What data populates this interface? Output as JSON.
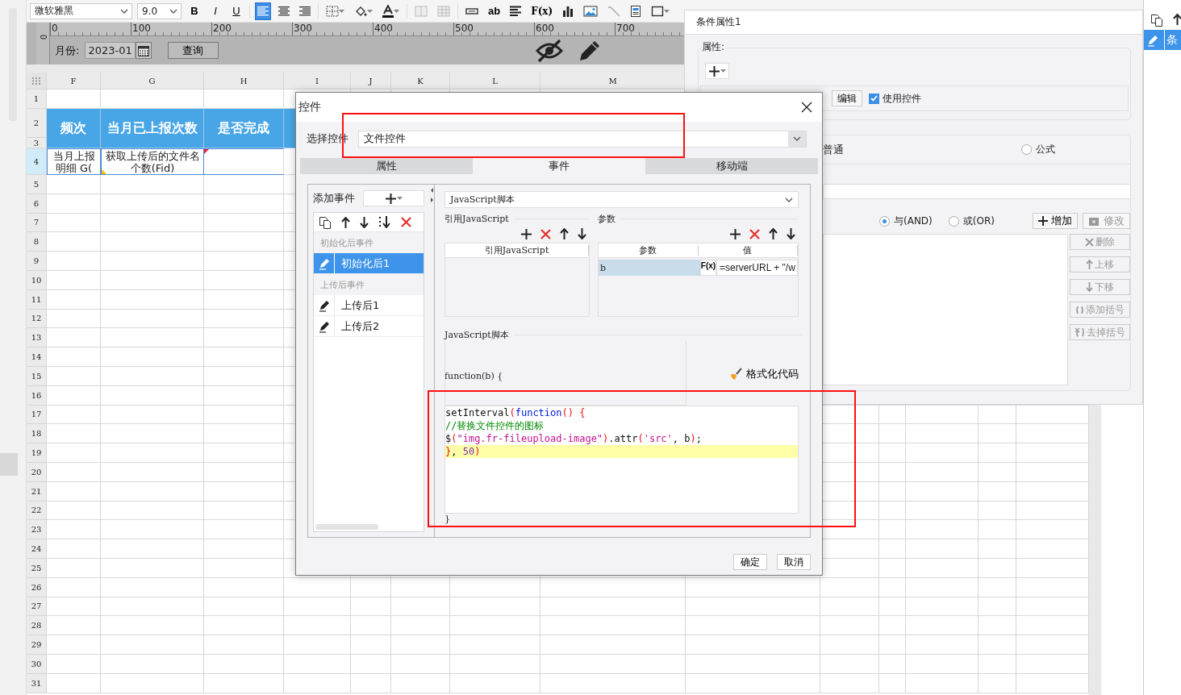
{
  "toolbar": {
    "font": "微软雅黑",
    "font_size": "9.0",
    "style_buttons": [
      "B",
      "I",
      "U"
    ],
    "align_buttons": [
      {
        "selected": true
      },
      {
        "selected": false
      },
      {
        "selected": false
      }
    ],
    "text_button": "ab",
    "formula_button": "F(x)"
  },
  "parameter_pane": {
    "ruler_labels": [
      "0",
      "100",
      "200",
      "300",
      "400",
      "500",
      "600",
      "700"
    ],
    "vertical_ruler_label": "0",
    "month_label": "月份:",
    "month_value": "2023-01",
    "query_button": "查询"
  },
  "sheet": {
    "columns": [
      "F",
      "G",
      "H",
      "I",
      "J",
      "K",
      "L",
      "M"
    ],
    "rows": [
      {
        "number": "1",
        "selected": false
      },
      {
        "number": "2",
        "selected": false
      },
      {
        "number": "3",
        "selected": false
      },
      {
        "number": "4",
        "selected": true
      },
      {
        "number": "5",
        "selected": false
      },
      {
        "number": "6",
        "selected": false
      },
      {
        "number": "7",
        "selected": false
      },
      {
        "number": "8",
        "selected": false
      },
      {
        "number": "9",
        "selected": false
      },
      {
        "number": "10",
        "selected": false
      },
      {
        "number": "11",
        "selected": false
      },
      {
        "number": "12",
        "selected": false
      },
      {
        "number": "13",
        "selected": false
      },
      {
        "number": "14",
        "selected": false
      },
      {
        "number": "15",
        "selected": false
      },
      {
        "number": "16",
        "selected": false
      },
      {
        "number": "17",
        "selected": false
      },
      {
        "number": "18",
        "selected": false
      },
      {
        "number": "19",
        "selected": false
      },
      {
        "number": "20",
        "selected": false
      },
      {
        "number": "21",
        "selected": false
      },
      {
        "number": "22",
        "selected": false
      },
      {
        "number": "23",
        "selected": false
      },
      {
        "number": "24",
        "selected": false
      },
      {
        "number": "25",
        "selected": false
      },
      {
        "number": "26",
        "selected": false
      },
      {
        "number": "27",
        "selected": false
      },
      {
        "number": "28",
        "selected": false
      },
      {
        "number": "29",
        "selected": false
      },
      {
        "number": "30",
        "selected": false
      },
      {
        "number": "31",
        "selected": false
      }
    ],
    "header_cells": [
      "频次",
      "当月已上报次数",
      "是否完成"
    ],
    "detail_cells": [
      "当月上报明细 G(",
      "获取上传后的文件名个数(Fid)"
    ]
  },
  "condition_panel": {
    "title": "条件属性1",
    "attributes_label": "属性:",
    "edit_button": "编辑",
    "use_widget": {
      "label": "使用控件",
      "checked": true
    },
    "normal_label": "普通",
    "formula_option": {
      "label": "公式",
      "selected": false
    },
    "join_options": [
      {
        "label": "与(AND)",
        "selected": true
      },
      {
        "label": "或(OR)",
        "selected": false
      }
    ],
    "add_button": {
      "label": "增加",
      "disabled": false
    },
    "modify_button": {
      "label": "修改",
      "disabled": true
    },
    "side_buttons": [
      {
        "kind": "delete",
        "label": "删除",
        "disabled": true
      },
      {
        "kind": "up",
        "label": "上移",
        "disabled": true
      },
      {
        "kind": "down",
        "label": "下移",
        "disabled": true
      },
      {
        "kind": "add-brackets",
        "label": "添加括号",
        "disabled": true
      },
      {
        "kind": "remove-brackets",
        "label": "去掉括号",
        "disabled": true
      }
    ]
  },
  "side_strip": {
    "item": {
      "label": "条",
      "selected": true
    }
  },
  "dialog": {
    "title": "控件",
    "select_label": "选择控件",
    "widget": "文件控件",
    "tabs": [
      {
        "label": "属性",
        "selected": false
      },
      {
        "label": "事件",
        "selected": true
      },
      {
        "label": "移动端",
        "selected": false
      }
    ],
    "add_event_label": "添加事件",
    "event_groups": [
      {
        "label": "初始化后事件",
        "events": [
          {
            "label": "初始化后1",
            "selected": true
          }
        ]
      },
      {
        "label": "上传后事件",
        "events": [
          {
            "label": "上传后1",
            "selected": false
          },
          {
            "label": "上传后2",
            "selected": false
          }
        ]
      }
    ],
    "action_type": "JavaScript脚本",
    "imports_label": "引用JavaScript",
    "imports_column": "引用JavaScript",
    "params_label": "参数",
    "params_columns": [
      "参数",
      "值"
    ],
    "params": [
      {
        "name": "b",
        "formula": "F(x)",
        "value": "=serverURL + \"/w"
      }
    ],
    "script_label": "JavaScript脚本",
    "function_header": "function(b) {",
    "format_button": "格式化代码",
    "code_lines": [
      {
        "highlighted": false,
        "tokens": [
          {
            "kind": "plain",
            "text": "setInterval"
          },
          {
            "kind": "punct",
            "text": "("
          },
          {
            "kind": "keyword",
            "text": "function"
          },
          {
            "kind": "punct",
            "text": "() {"
          }
        ]
      },
      {
        "highlighted": false,
        "tokens": [
          {
            "kind": "comment",
            "text": "//替换文件控件的图标"
          }
        ]
      },
      {
        "highlighted": false,
        "tokens": [
          {
            "kind": "plain",
            "text": "$"
          },
          {
            "kind": "punct",
            "text": "("
          },
          {
            "kind": "string",
            "text": "\"img.fr-fileupload-image\""
          },
          {
            "kind": "punct",
            "text": ")"
          },
          {
            "kind": "plain",
            "text": ".attr"
          },
          {
            "kind": "punct",
            "text": "("
          },
          {
            "kind": "string",
            "text": "'src'"
          },
          {
            "kind": "plain",
            "text": ", b"
          },
          {
            "kind": "punct",
            "text": ")"
          },
          {
            "kind": "plain",
            "text": ";"
          }
        ]
      },
      {
        "highlighted": true,
        "tokens": [
          {
            "kind": "punct",
            "text": "}"
          },
          {
            "kind": "plain",
            "text": ", "
          },
          {
            "kind": "number",
            "text": "50"
          },
          {
            "kind": "punct",
            "text": ")"
          }
        ]
      }
    ],
    "function_footer": "}",
    "buttons": [
      "确定",
      "取消"
    ]
  }
}
